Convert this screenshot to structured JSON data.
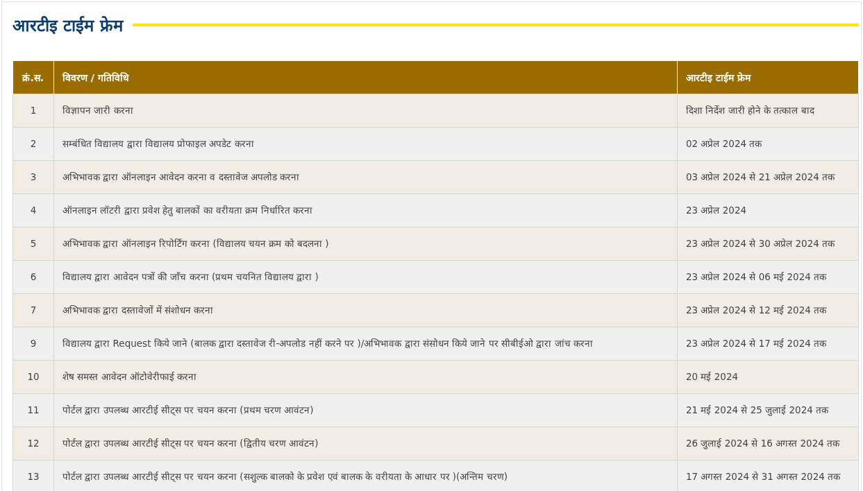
{
  "title": "आरटीइ टाईम फ्रेम",
  "table": {
    "columns": [
      "क्रं.स.",
      "विवरण / गतिविधि",
      "आरटीइ टाईम फ्रेम"
    ],
    "rows": [
      [
        "1",
        "विज्ञापन जारी करना",
        "दिशा निर्देश जारी होने के तत्काल बाद"
      ],
      [
        "2",
        "सम्बंधित विद्यालय द्वारा विद्यालय प्रोफाइल अपडेट करना",
        "02 अप्रेल 2024 तक"
      ],
      [
        "3",
        "अभिभावक द्वारा ऑनलाइन आवेदन करना व दस्तावेज अपलोड करना",
        "03 अप्रेल 2024 से 21 अप्रेल 2024 तक"
      ],
      [
        "4",
        "ऑनलाइन लॉटरी द्वारा प्रवेश हेतु बालकों का वरीयता क्रम निर्धारित करना",
        "23 अप्रेल 2024"
      ],
      [
        "5",
        "अभिभावक द्वारा ऑनलाइन रिपोर्टिंग करना (विद्यालय चयन क्रम को बदलना )",
        "23 अप्रेल 2024 से 30 अप्रेल 2024 तक"
      ],
      [
        "6",
        "विद्यालय द्वारा आवेदन पत्रों की जाँच करना (प्रथम चयनित विद्यालय द्वारा )",
        "23 अप्रेल 2024 से 06 मई 2024 तक"
      ],
      [
        "7",
        "अभिभावक द्वारा दस्तावेजों में संशोधन करना",
        "23 अप्रेल 2024 से 12 मई 2024 तक"
      ],
      [
        "9",
        "विद्यालय द्वारा Request किये जाने (बालक द्वारा दस्तावेज री-अपलोड नहीं करने पर )/अभिभावक द्वारा संसोधन किये जाने पर सीबीईओ द्वारा जांच करना",
        "23 अप्रेल 2024 से 17 मई 2024 तक"
      ],
      [
        "10",
        "शेष समस्त आवेदन ऑटोवेरीफाई करना",
        "20 मई 2024"
      ],
      [
        "11",
        "पोर्टल द्वारा उपलब्ध आरटीई सीट्स पर चयन करना (प्रथम चरण आवंटन)",
        "21 मई 2024 से 25 जुलाई 2024 तक"
      ],
      [
        "12",
        "पोर्टल द्वारा उपलब्ध आरटीई सीट्स पर चयन करना (द्वितीय चरण आवंटन)",
        "26 जुलाई 2024 से 16 अगस्त 2024 तक"
      ],
      [
        "13",
        "पोर्टल द्वारा उपलब्ध आरटीई सीट्स पर चयन करना (सशुल्क बालको के प्रवेश एवं बालक के वरीयता के आधार पर )(अन्तिम चरण)",
        "17 अगस्त 2024 से 31 अगस्त 2024 तक"
      ]
    ]
  }
}
